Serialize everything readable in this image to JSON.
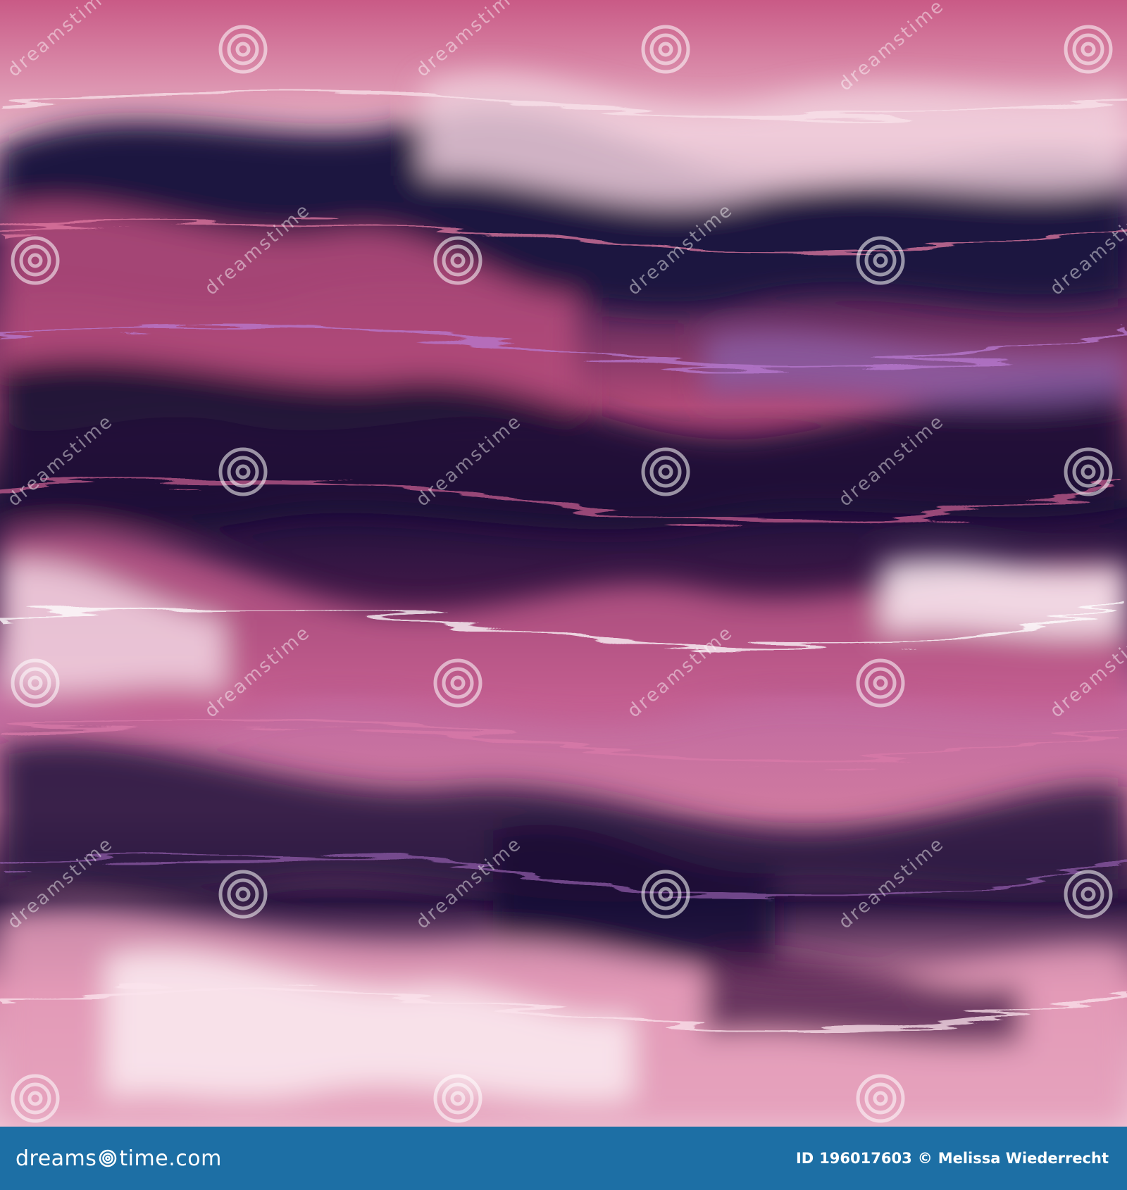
{
  "image": {
    "description_icon": "abstract-wave-pattern",
    "palette": [
      "#1b1036",
      "#2a1548",
      "#5a1f52",
      "#b24a78",
      "#d9799e",
      "#f4d6e0",
      "#8a5fa6",
      "#3a0f2a"
    ]
  },
  "watermark": {
    "text": "dreamstime",
    "icon": "spiral-icon"
  },
  "footer": {
    "logo_prefix": "dreams",
    "logo_suffix": "time.com",
    "id_label": "ID",
    "id_value": "196017603",
    "copyright": "©",
    "author": "Melissa Wiederrecht",
    "background": "#1d6fa5"
  }
}
